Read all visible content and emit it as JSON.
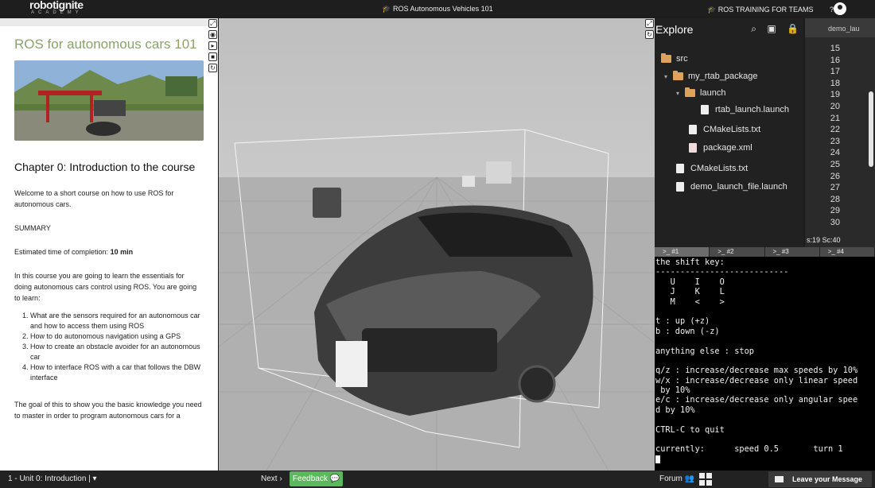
{
  "topbar": {
    "logo_main": "robotignite",
    "logo_sub": "ACADEMY",
    "course": "🎓 ROS Autonomous Vehicles 101",
    "teams": "🎓 ROS TRAINING FOR TEAMS",
    "help": "???"
  },
  "left": {
    "title": "ROS for autonomous cars 101",
    "chapter": "Chapter 0: Introduction to the course",
    "intro": "Welcome to a short course on how to use ROS for autonomous cars.",
    "summary": "SUMMARY",
    "time_label": "Estimated time of completion: ",
    "time_value": "10 min",
    "learn": "In this course you are going to learn the essentials for doing autonomous cars control using ROS. You are going to learn:",
    "items": [
      "What are the sensors required for an autonomous car and how to access them using ROS",
      "How to do autonomous navigation using a GPS",
      "How to create an obstacle avoider for an autonomous car",
      "How to interface ROS with a car that follows the DBW interface"
    ],
    "goal": "The goal of this to show you the basic knowledge you need to master in order to program autonomous cars for a"
  },
  "explorer": {
    "title": "Explore",
    "tree": [
      {
        "label": "src",
        "kind": "folder"
      },
      {
        "label": "my_rtab_package",
        "kind": "folder"
      },
      {
        "label": "launch",
        "kind": "folder"
      },
      {
        "label": "rtab_launch.launch",
        "kind": "file"
      },
      {
        "label": "CMakeLists.txt",
        "kind": "file"
      },
      {
        "label": "package.xml",
        "kind": "xml"
      },
      {
        "label": "CMakeLists.txt",
        "kind": "file"
      },
      {
        "label": "demo_launch_file.launch",
        "kind": "file"
      }
    ]
  },
  "editor": {
    "tab": "demo_lau",
    "lines": [
      "15",
      "16",
      "17",
      "18",
      "19",
      "20",
      "21",
      "22",
      "23",
      "24",
      "25",
      "26",
      "27",
      "28",
      "29",
      "30"
    ],
    "status": "s:19 Sc:40"
  },
  "terminal": {
    "tabs": [
      ">_ #1",
      ">_ #2",
      ">_ #3",
      ">_ #4"
    ],
    "lines": [
      "the shift key:",
      "---------------------------",
      "   U    I    O",
      "   J    K    L",
      "   M    <    >",
      "",
      "t : up (+z)",
      "b : down (-z)",
      "",
      "anything else : stop",
      "",
      "q/z : increase/decrease max speeds by 10%",
      "w/x : increase/decrease only linear speed",
      " by 10%",
      "e/c : increase/decrease only angular spee",
      "d by 10%",
      "",
      "CTRL-C to quit",
      "",
      "currently:      speed 0.5       turn 1"
    ]
  },
  "bottom": {
    "unit": "1 - Unit 0: Introduction | ▾",
    "next": "Next ›",
    "feedback": "Feedback 💬",
    "forum": "Forum 👥",
    "leave": "Leave your Message"
  }
}
